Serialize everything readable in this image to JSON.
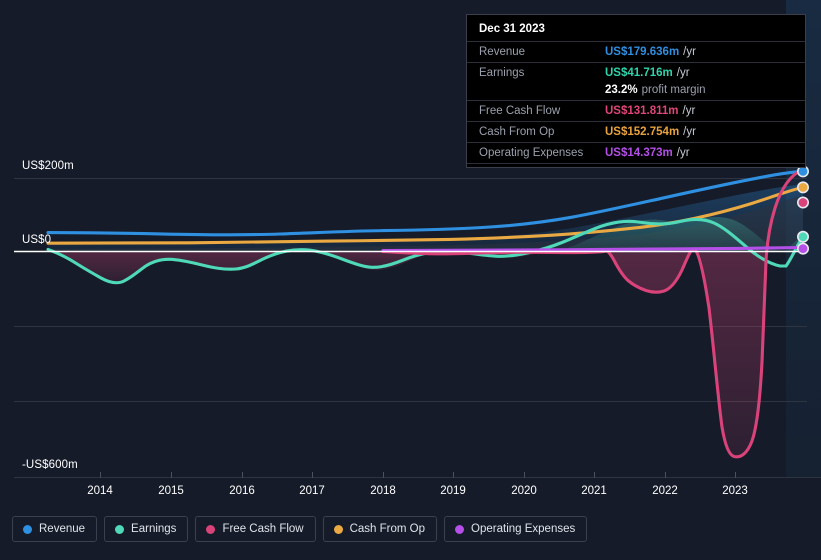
{
  "tooltip": {
    "date": "Dec 31 2023",
    "rows": [
      {
        "label": "Revenue",
        "value": "US$179.636m",
        "unit": "/yr",
        "color": "#2f8fe0"
      },
      {
        "label": "Earnings",
        "value": "US$41.716m",
        "unit": "/yr",
        "color": "#2fd4ab"
      },
      {
        "label": "Free Cash Flow",
        "value": "US$131.811m",
        "unit": "/yr",
        "color": "#e0457b"
      },
      {
        "label": "Cash From Op",
        "value": "US$152.754m",
        "unit": "/yr",
        "color": "#e8a33d"
      },
      {
        "label": "Operating Expenses",
        "value": "US$14.373m",
        "unit": "/yr",
        "color": "#b450e8"
      }
    ],
    "profit_margin_value": "23.2%",
    "profit_margin_label": "profit margin"
  },
  "legend": [
    {
      "label": "Revenue",
      "color": "#2f8fe0"
    },
    {
      "label": "Earnings",
      "color": "#4fd9b8"
    },
    {
      "label": "Free Cash Flow",
      "color": "#d9437a"
    },
    {
      "label": "Cash From Op",
      "color": "#eaa942"
    },
    {
      "label": "Operating Expenses",
      "color": "#b450e8"
    }
  ],
  "axes": {
    "y_labels": [
      "US$200m",
      "US$0",
      "-US$600m"
    ],
    "y_top_label": "US$200m",
    "y_zero_label": "US$0",
    "y_bottom_label": "-US$600m",
    "x_labels": [
      "2014",
      "2015",
      "2016",
      "2017",
      "2018",
      "2019",
      "2020",
      "2021",
      "2022",
      "2023"
    ]
  },
  "chart_data": {
    "type": "area",
    "title": "",
    "xlabel": "",
    "ylabel": "US$",
    "ylim": [
      -600,
      200
    ],
    "xlim": [
      2013.3,
      2024.0
    ],
    "grid": true,
    "legend_position": "bottom",
    "y_ticks": [
      200,
      0,
      -200,
      -400,
      -600
    ],
    "y_tick_labels": [
      "US$200m",
      "US$0",
      "",
      "",
      "-US$600m"
    ],
    "categories": [
      "2014",
      "2015",
      "2016",
      "2017",
      "2018",
      "2019",
      "2020",
      "2021",
      "2022",
      "2023"
    ],
    "x": [
      2013.3,
      2013.6,
      2014.0,
      2014.4,
      2014.8,
      2015.2,
      2015.6,
      2016.0,
      2016.4,
      2016.8,
      2017.2,
      2017.6,
      2018.0,
      2018.4,
      2018.8,
      2019.2,
      2019.6,
      2020.0,
      2020.4,
      2020.8,
      2021.2,
      2021.6,
      2022.0,
      2022.4,
      2022.8,
      2023.2,
      2023.6,
      2024.0
    ],
    "series": [
      {
        "name": "Revenue",
        "color": "#2f8fe0",
        "values": [
          25,
          25,
          25,
          24,
          24,
          23,
          23,
          24,
          26,
          27,
          27,
          26,
          26,
          27,
          28,
          30,
          34,
          41,
          47,
          54,
          62,
          78,
          95,
          112,
          132,
          152,
          168,
          179.636
        ]
      },
      {
        "name": "Earnings",
        "color": "#4fd9b8",
        "values": [
          -5,
          -18,
          -30,
          -48,
          -70,
          -50,
          -36,
          -30,
          -35,
          -12,
          -10,
          -18,
          -30,
          -42,
          -38,
          -27,
          -18,
          -8,
          -2,
          6,
          -8,
          -14,
          -12,
          2,
          14,
          22,
          12,
          41.716
        ]
      },
      {
        "name": "Free Cash Flow",
        "color": "#d9437a",
        "values": [
          null,
          null,
          null,
          null,
          null,
          null,
          null,
          null,
          null,
          null,
          null,
          null,
          -6,
          -10,
          -8,
          -9,
          -8,
          -6,
          -5,
          -4,
          -2,
          -62,
          -86,
          -2,
          -520,
          -560,
          -280,
          131.811
        ]
      },
      {
        "name": "Cash From Op",
        "color": "#eaa942",
        "values": [
          6,
          6,
          6,
          6,
          6,
          6,
          6,
          7,
          8,
          9,
          9,
          9,
          9,
          10,
          10,
          12,
          15,
          20,
          25,
          31,
          38,
          50,
          64,
          80,
          100,
          122,
          140,
          152.754
        ]
      },
      {
        "name": "Operating Expenses",
        "color": "#b450e8",
        "values": [
          null,
          null,
          null,
          null,
          null,
          null,
          null,
          null,
          null,
          null,
          null,
          null,
          1,
          1,
          1,
          2,
          2,
          2,
          3,
          3,
          4,
          5,
          6,
          7,
          9,
          11,
          13,
          14.373
        ]
      }
    ]
  }
}
